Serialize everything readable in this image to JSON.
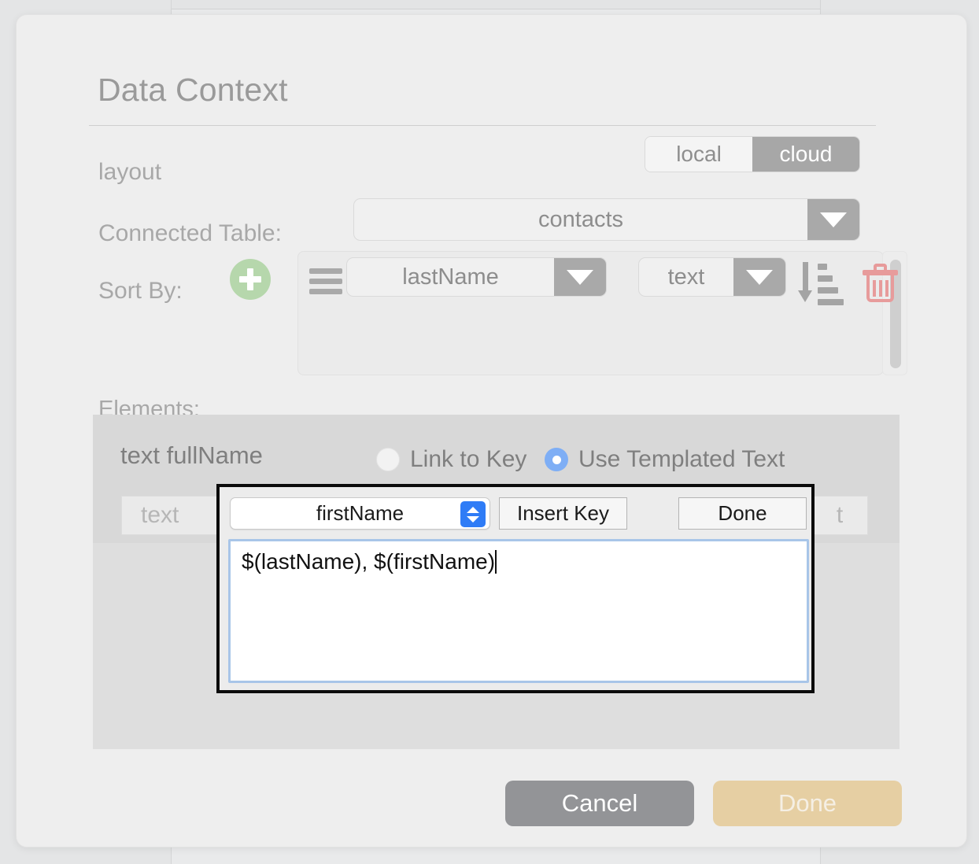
{
  "window": {
    "title": "Data Context"
  },
  "layout_row": {
    "label": "layout",
    "segmented": {
      "options": [
        "local",
        "cloud"
      ],
      "selected": "cloud",
      "selected_bg": "#a7a7a7"
    }
  },
  "connected_table": {
    "label": "Connected Table:",
    "value": "contacts",
    "arrow_icon": "chevron-down-icon"
  },
  "sort_by": {
    "label": "Sort By:",
    "add_icon": "plus-circle-icon",
    "add_color": "#b6d7ac",
    "rows": [
      {
        "drag_icon": "drag-handle-icon",
        "field": "lastName",
        "type": "text",
        "direction_icon": "sort-descending-icon",
        "delete_icon": "trash-icon",
        "delete_color": "#e79b9b"
      }
    ]
  },
  "elements": {
    "label": "Elements:",
    "rows": [
      {
        "name": "text fullName",
        "options": [
          {
            "label": "Link to Key",
            "selected": false
          },
          {
            "label": "Use Templated Text",
            "selected": true
          }
        ],
        "selected_color": "#7eaef5",
        "left_field_value": "text",
        "right_field_value": "t"
      }
    ]
  },
  "template_editor": {
    "key_select_value": "firstName",
    "stepper_icon": "stepper-up-down-icon",
    "stepper_color": "#2f7cf6",
    "insert_key_label": "Insert Key",
    "done_label": "Done",
    "template_text": "$(lastName), $(firstName)"
  },
  "footer": {
    "cancel_label": "Cancel",
    "cancel_color": "#939497",
    "done_label": "Done",
    "done_color": "#e6cfa3"
  }
}
